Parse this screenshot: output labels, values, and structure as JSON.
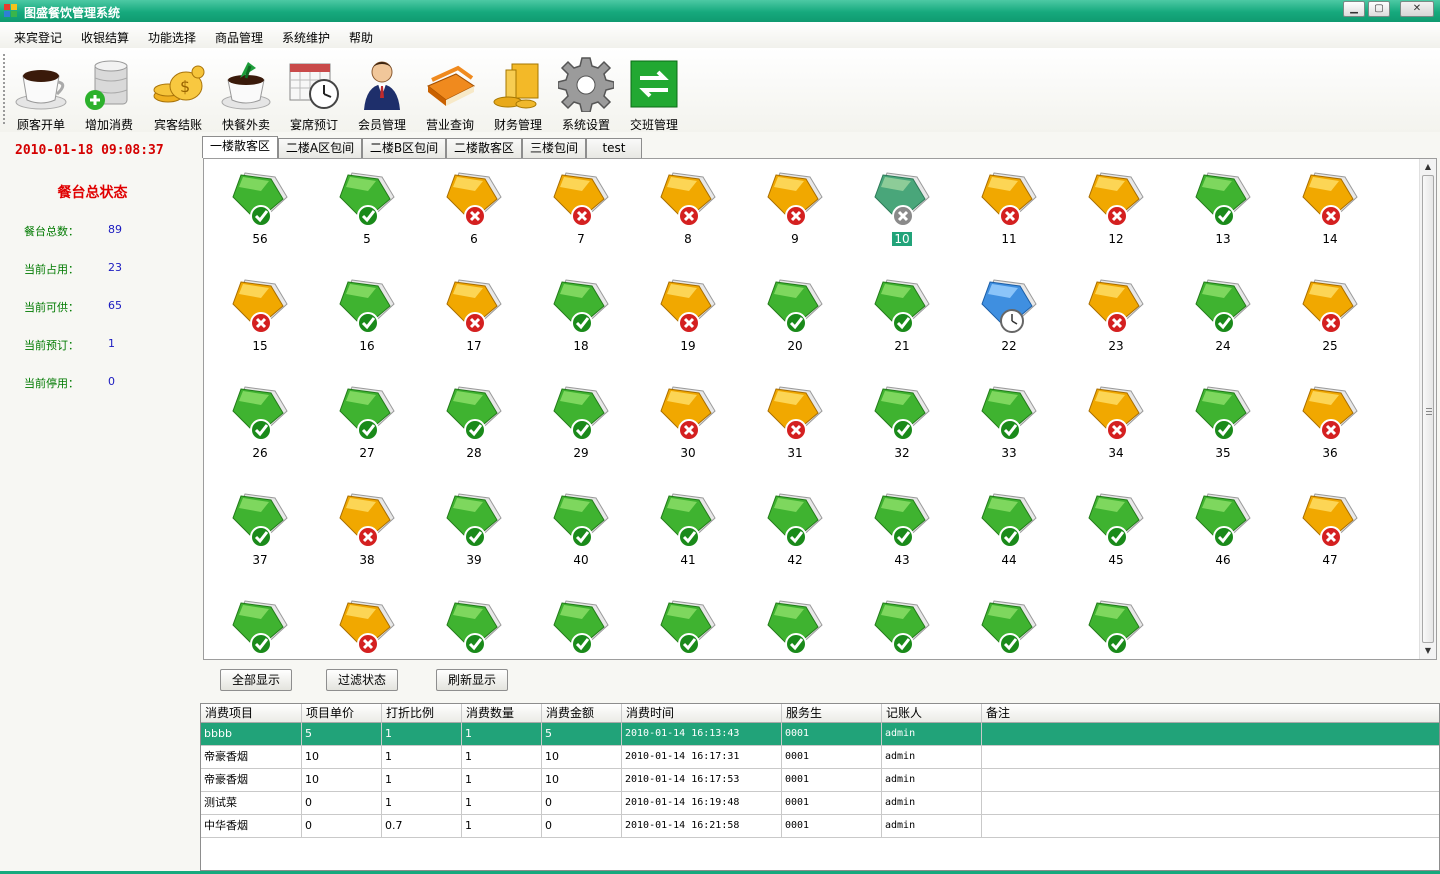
{
  "window": {
    "title": "图盛餐饮管理系统",
    "min_label": "▁",
    "max_label": "▢",
    "close_label": "✕"
  },
  "menu": [
    "来宾登记",
    "收银结算",
    "功能选择",
    "商品管理",
    "系统维护",
    "帮助"
  ],
  "toolbar": [
    {
      "label": "顾客开单",
      "icon": "coffee-cup-icon"
    },
    {
      "label": "增加消费",
      "icon": "database-add-icon"
    },
    {
      "label": "宾客结账",
      "icon": "gold-coins-icon"
    },
    {
      "label": "快餐外卖",
      "icon": "takeaway-cup-icon"
    },
    {
      "label": "宴席预订",
      "icon": "calendar-clock-icon"
    },
    {
      "label": "会员管理",
      "icon": "member-person-icon"
    },
    {
      "label": "营业查询",
      "icon": "books-icon"
    },
    {
      "label": "财务管理",
      "icon": "finance-icon"
    },
    {
      "label": "系统设置",
      "icon": "gear-icon"
    },
    {
      "label": "交班管理",
      "icon": "swap-arrows-icon"
    }
  ],
  "left_panel": {
    "clock": "2010-01-18 09:08:37",
    "status_title": "餐台总状态",
    "stats": [
      {
        "label": "餐台总数：",
        "value": "89"
      },
      {
        "label": "当前占用：",
        "value": "23"
      },
      {
        "label": "当前可供：",
        "value": "65"
      },
      {
        "label": "当前预订：",
        "value": "1"
      },
      {
        "label": "当前停用：",
        "value": "0"
      }
    ]
  },
  "tabs": [
    "一楼散客区",
    "二楼A区包间",
    "二楼B区包间",
    "二楼散客区",
    "三楼包间",
    "test"
  ],
  "active_tab": 0,
  "status_colors": {
    "available": "#3fc23f",
    "occupied": "#f3b300",
    "reserved": "#3f9de8",
    "selected": "#21a379"
  },
  "tables": [
    {
      "num": "56",
      "status": "available"
    },
    {
      "num": "5",
      "status": "available"
    },
    {
      "num": "6",
      "status": "occupied"
    },
    {
      "num": "7",
      "status": "occupied"
    },
    {
      "num": "8",
      "status": "occupied"
    },
    {
      "num": "9",
      "status": "occupied"
    },
    {
      "num": "10",
      "status": "selected"
    },
    {
      "num": "11",
      "status": "occupied"
    },
    {
      "num": "12",
      "status": "occupied"
    },
    {
      "num": "13",
      "status": "available"
    },
    {
      "num": "14",
      "status": "occupied"
    },
    {
      "num": "15",
      "status": "occupied"
    },
    {
      "num": "16",
      "status": "available"
    },
    {
      "num": "17",
      "status": "occupied"
    },
    {
      "num": "18",
      "status": "available"
    },
    {
      "num": "19",
      "status": "occupied"
    },
    {
      "num": "20",
      "status": "available"
    },
    {
      "num": "21",
      "status": "available"
    },
    {
      "num": "22",
      "status": "reserved"
    },
    {
      "num": "23",
      "status": "occupied"
    },
    {
      "num": "24",
      "status": "available"
    },
    {
      "num": "25",
      "status": "occupied"
    },
    {
      "num": "26",
      "status": "available"
    },
    {
      "num": "27",
      "status": "available"
    },
    {
      "num": "28",
      "status": "available"
    },
    {
      "num": "29",
      "status": "available"
    },
    {
      "num": "30",
      "status": "occupied"
    },
    {
      "num": "31",
      "status": "occupied"
    },
    {
      "num": "32",
      "status": "available"
    },
    {
      "num": "33",
      "status": "available"
    },
    {
      "num": "34",
      "status": "occupied"
    },
    {
      "num": "35",
      "status": "available"
    },
    {
      "num": "36",
      "status": "occupied"
    },
    {
      "num": "37",
      "status": "available"
    },
    {
      "num": "38",
      "status": "occupied"
    },
    {
      "num": "39",
      "status": "available"
    },
    {
      "num": "40",
      "status": "available"
    },
    {
      "num": "41",
      "status": "available"
    },
    {
      "num": "42",
      "status": "available"
    },
    {
      "num": "43",
      "status": "available"
    },
    {
      "num": "44",
      "status": "available"
    },
    {
      "num": "45",
      "status": "available"
    },
    {
      "num": "46",
      "status": "available"
    },
    {
      "num": "47",
      "status": "occupied"
    },
    {
      "num": "",
      "status": "available"
    },
    {
      "num": "",
      "status": "occupied"
    },
    {
      "num": "",
      "status": "available"
    },
    {
      "num": "",
      "status": "available"
    },
    {
      "num": "",
      "status": "available"
    },
    {
      "num": "",
      "status": "available"
    },
    {
      "num": "",
      "status": "available"
    },
    {
      "num": "",
      "status": "available"
    },
    {
      "num": "",
      "status": "available"
    }
  ],
  "buttons": {
    "show_all": "全部显示",
    "filter": "过滤状态",
    "refresh": "刷新显示"
  },
  "consumption": {
    "headers": [
      "消费项目",
      "项目单价",
      "打折比例",
      "消费数量",
      "消费金额",
      "消费时间",
      "服务生",
      "记账人",
      "备注"
    ],
    "rows": [
      [
        "bbbb",
        "5",
        "1",
        "1",
        "5",
        "2010-01-14 16:13:43",
        "0001",
        "admin",
        ""
      ],
      [
        "帝豪香烟",
        "10",
        "1",
        "1",
        "10",
        "2010-01-14 16:17:31",
        "0001",
        "admin",
        ""
      ],
      [
        "帝豪香烟",
        "10",
        "1",
        "1",
        "10",
        "2010-01-14 16:17:53",
        "0001",
        "admin",
        ""
      ],
      [
        "测试菜",
        "0",
        "1",
        "1",
        "0",
        "2010-01-14 16:19:48",
        "0001",
        "admin",
        ""
      ],
      [
        "中华香烟",
        "0",
        "0.7",
        "1",
        "0",
        "2010-01-14 16:21:58",
        "0001",
        "admin",
        ""
      ]
    ],
    "selected_row": 0
  }
}
